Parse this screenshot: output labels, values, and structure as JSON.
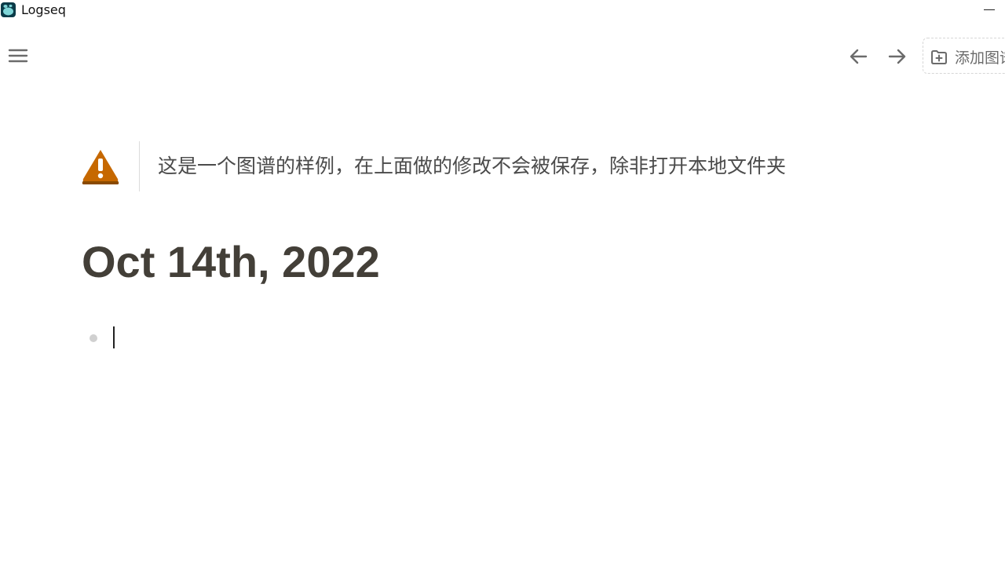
{
  "window": {
    "title": "Logseq"
  },
  "header": {
    "add_graph_label": "添加图谱"
  },
  "warning": {
    "text": "这是一个图谱的样例，在上面做的修改不会被保存，除非打开本地文件夹"
  },
  "page": {
    "title": "Oct 14th, 2022"
  },
  "blocks": [
    {
      "content": ""
    }
  ],
  "colors": {
    "warning_icon": "#c66800",
    "title_text": "#433f38",
    "bullet": "#d0d0d0"
  }
}
